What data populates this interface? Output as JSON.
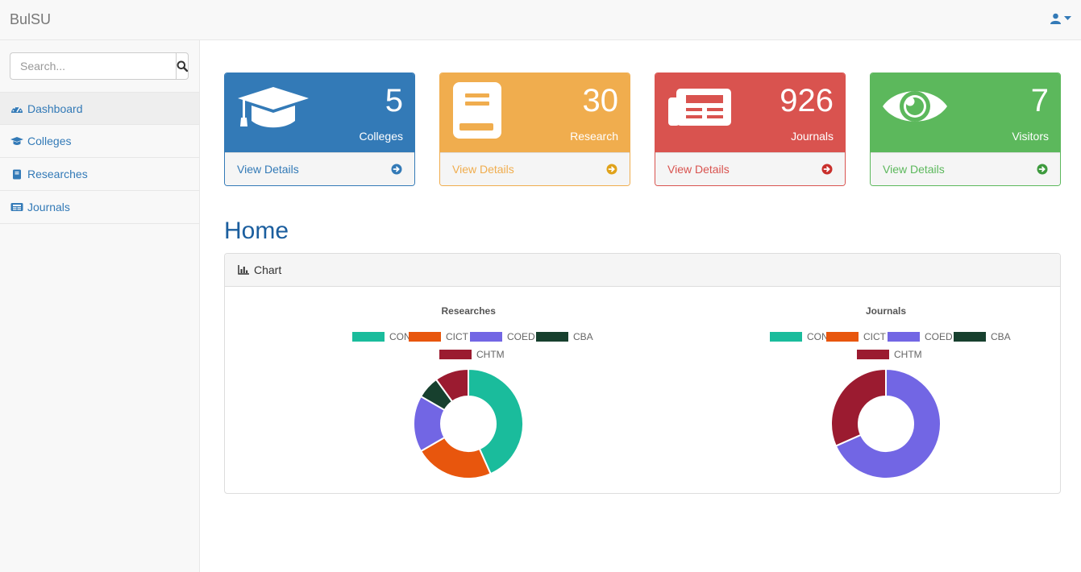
{
  "navbar": {
    "brand": "BulSU"
  },
  "sidebar": {
    "search_placeholder": "Search...",
    "items": [
      {
        "label": "Dashboard",
        "icon": "dashboard-icon"
      },
      {
        "label": "Colleges",
        "icon": "graduation-cap-icon"
      },
      {
        "label": "Researches",
        "icon": "book-icon"
      },
      {
        "label": "Journals",
        "icon": "newspaper-icon"
      }
    ]
  },
  "cards": [
    {
      "number": "5",
      "label": "Colleges",
      "link": "View Details",
      "color": "#337ab7",
      "icon": "graduation-cap-icon"
    },
    {
      "number": "30",
      "label": "Research",
      "link": "View Details",
      "color": "#f0ad4e",
      "icon": "book-icon"
    },
    {
      "number": "926",
      "label": "Journals",
      "link": "View Details",
      "color": "#d9534f",
      "icon": "newspaper-icon"
    },
    {
      "number": "7",
      "label": "Visitors",
      "link": "View Details",
      "color": "#5cb85c",
      "icon": "eye-icon"
    }
  ],
  "main": {
    "title": "Home",
    "chart_panel_label": "Chart"
  },
  "chart_data": [
    {
      "type": "pie",
      "title": "Researches",
      "categories": [
        "CON",
        "CICT",
        "COED",
        "CBA",
        "CHTM"
      ],
      "values": [
        13,
        7,
        5,
        2,
        3
      ],
      "colors": [
        "#1abc9c",
        "#e8560d",
        "#7266e4",
        "#17402e",
        "#9b1b30"
      ],
      "legend": "top"
    },
    {
      "type": "pie",
      "title": "Journals",
      "categories": [
        "CON",
        "CICT",
        "COED",
        "CBA",
        "CHTM"
      ],
      "values": [
        0,
        0,
        633,
        0,
        293
      ],
      "colors": [
        "#1abc9c",
        "#e8560d",
        "#7266e4",
        "#17402e",
        "#9b1b30"
      ],
      "legend": "top"
    }
  ]
}
